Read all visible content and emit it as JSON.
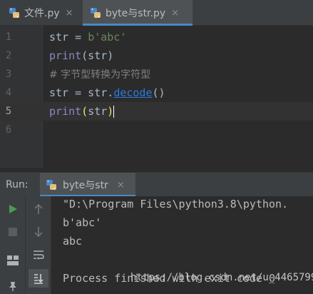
{
  "tabs": [
    {
      "label": "文件.py",
      "close": "×"
    },
    {
      "label": "byte与str.py",
      "close": "×"
    }
  ],
  "editor": {
    "lines": [
      {
        "number": "1"
      },
      {
        "number": "2"
      },
      {
        "number": "3"
      },
      {
        "number": "4"
      },
      {
        "number": "5"
      },
      {
        "number": "6"
      }
    ],
    "code": {
      "l1_var": "str = ",
      "l1_str": "b'abc'",
      "l2_fn": "print",
      "l2_rest": "(str)",
      "l3_comment": "# 字节型转换为字符型",
      "l4_pre": "str = str.",
      "l4_method": "decode",
      "l4_post": "()",
      "l5_fn": "print",
      "l5_open": "(",
      "l5_arg": "str",
      "l5_close": ")"
    }
  },
  "run_panel": {
    "label": "Run:",
    "tab_label": "byte与str",
    "tab_close": "×",
    "output": [
      "\"D:\\Program Files\\python3.8\\python.",
      "b'abc'",
      "abc",
      "",
      "Process finished with exit code 0"
    ],
    "watermark": "https://blog.csdn.net/u_4465799"
  },
  "colors": {
    "accent": "#4a88c7",
    "run_green": "#499c54",
    "keyword": "#cc7832",
    "string": "#6a8759",
    "comment": "#808080"
  }
}
